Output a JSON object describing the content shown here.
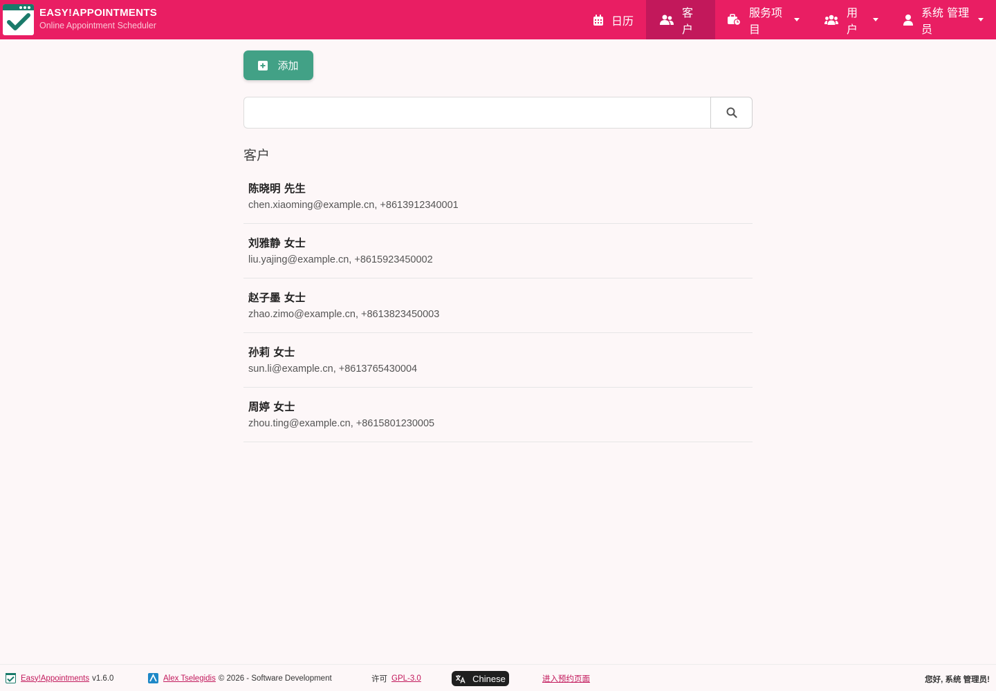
{
  "brand": {
    "title": "EASY!APPOINTMENTS",
    "subtitle": "Online Appointment Scheduler",
    "logo_icon": "calendar-check-logo-icon"
  },
  "nav": [
    {
      "label": "日历",
      "icon": "calendar-icon",
      "active": false,
      "dropdown": false
    },
    {
      "label": "客户",
      "icon": "users-icon",
      "active": true,
      "dropdown": false
    },
    {
      "label": "服务项目",
      "icon": "briefcase-clock-icon",
      "active": false,
      "dropdown": true
    },
    {
      "label": "用户",
      "icon": "user-group-icon",
      "active": false,
      "dropdown": true
    },
    {
      "label": "系统 管理员",
      "icon": "user-icon",
      "active": false,
      "dropdown": true
    }
  ],
  "toolbar": {
    "add_label": "添加"
  },
  "search": {
    "value": "",
    "placeholder": ""
  },
  "customers": {
    "section_title": "客户",
    "items": [
      {
        "name": "陈晓明 先生",
        "info": "chen.xiaoming@example.cn, +8613912340001"
      },
      {
        "name": "刘雅静 女士",
        "info": "liu.yajing@example.cn, +8615923450002"
      },
      {
        "name": "赵子墨 女士",
        "info": "zhao.zimo@example.cn, +8613823450003"
      },
      {
        "name": "孙莉 女士",
        "info": "sun.li@example.cn, +8613765430004"
      },
      {
        "name": "周婷 女士",
        "info": "zhou.ting@example.cn, +8615801230005"
      }
    ]
  },
  "footer": {
    "app_link": "Easy!Appointments",
    "version": "v1.6.0",
    "author_link": "Alex Tselegidis",
    "copyright": "© 2026 - Software Development",
    "license_label": "许可",
    "license_link": "GPL-3.0",
    "language": "Chinese",
    "booking_link": "进入预约页面",
    "greeting": "您好, 系统 管理员!"
  },
  "colors": {
    "header": "#e91e63",
    "nav_active": "#c2185b",
    "add_button": "#42a186",
    "page_bg": "#fdf7f8"
  }
}
